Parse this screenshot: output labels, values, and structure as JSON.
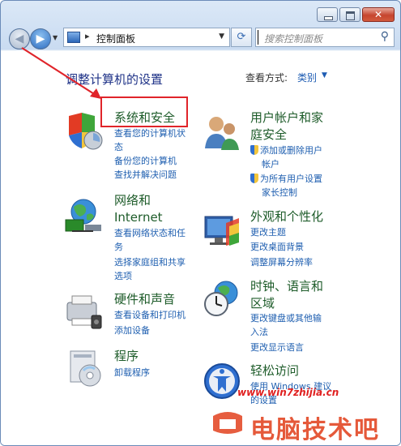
{
  "window": {
    "address": {
      "location": "控制面板"
    },
    "search": {
      "placeholder": "搜索控制面板"
    }
  },
  "page": {
    "title": "调整计算机的设置",
    "view_label": "查看方式:",
    "view_value": "类别"
  },
  "categories": [
    {
      "title": "系统和安全",
      "icon": "system-security-icon",
      "links": [
        "查看您的计算机状",
        "态",
        "备份您的计算机",
        "查找并解决问题"
      ]
    },
    {
      "title": "网络和",
      "title2": "Internet",
      "icon": "network-icon",
      "links": [
        "查看网络状态和任",
        "务",
        "选择家庭组和共享",
        "选项"
      ]
    },
    {
      "title": "硬件和声音",
      "icon": "hardware-sound-icon",
      "links": [
        "查看设备和打印机",
        "添加设备"
      ]
    },
    {
      "title": "程序",
      "icon": "programs-icon",
      "links": [
        "卸载程序"
      ]
    },
    {
      "title": "用户帐户和家",
      "title2": "庭安全",
      "icon": "user-accounts-icon",
      "links": [
        "添加或删除用户",
        "帐户",
        "为所有用户设置",
        "家长控制"
      ]
    },
    {
      "title": "外观和个性化",
      "icon": "appearance-icon",
      "links": [
        "更改主题",
        "更改桌面背景",
        "调整屏幕分辨率"
      ]
    },
    {
      "title": "时钟、语言和",
      "title2": "区域",
      "icon": "clock-region-icon",
      "links": [
        "更改键盘或其他输",
        "入法",
        "更改显示语言"
      ]
    },
    {
      "title": "轻松访问",
      "icon": "ease-of-access-icon",
      "links": [
        "使用 Windows 建议",
        "的设置"
      ]
    }
  ],
  "overlay": {
    "watermark": "www.win7zhijia.cn",
    "brand": "电脑技术吧",
    "annotation_color": "#e0242a"
  }
}
